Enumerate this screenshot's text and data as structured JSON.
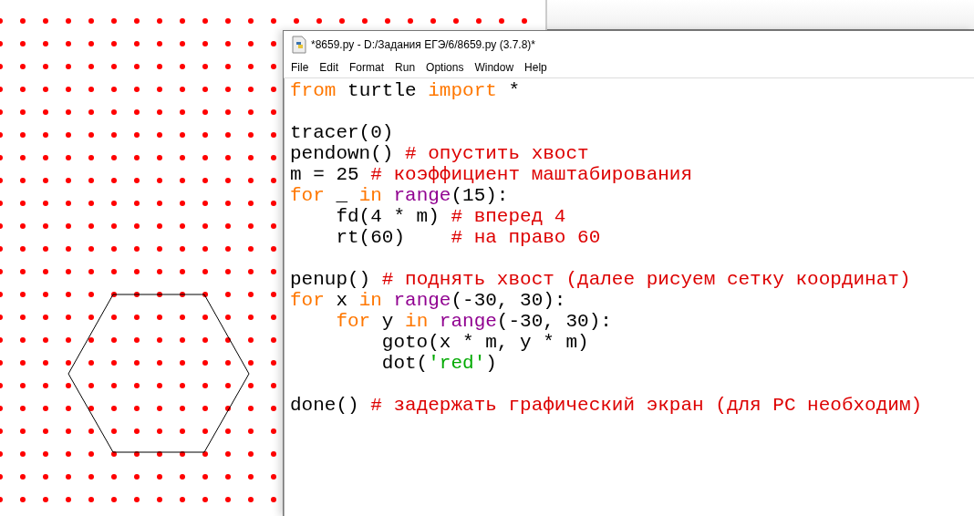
{
  "editor": {
    "title": "*8659.py - D:/Задания ЕГЭ/6/8659.py (3.7.8)*",
    "menu": [
      "File",
      "Edit",
      "Format",
      "Run",
      "Options",
      "Window",
      "Help"
    ],
    "code_lines": [
      {
        "kind": "code",
        "segments": [
          {
            "kind": "keyword",
            "text": "from"
          },
          {
            "kind": "plain",
            "text": " turtle "
          },
          {
            "kind": "keyword",
            "text": "import"
          },
          {
            "kind": "plain",
            "text": " *"
          }
        ]
      },
      {
        "kind": "blank"
      },
      {
        "kind": "code",
        "segments": [
          {
            "kind": "plain",
            "text": "tracer(0)"
          }
        ]
      },
      {
        "kind": "code",
        "segments": [
          {
            "kind": "plain",
            "text": "pendown() "
          },
          {
            "kind": "comment",
            "text": "# опустить хвост"
          }
        ]
      },
      {
        "kind": "code",
        "segments": [
          {
            "kind": "plain",
            "text": "m = 25 "
          },
          {
            "kind": "comment",
            "text": "# коэффициент маштабирования"
          }
        ]
      },
      {
        "kind": "code",
        "segments": [
          {
            "kind": "keyword",
            "text": "for"
          },
          {
            "kind": "plain",
            "text": " _ "
          },
          {
            "kind": "keyword",
            "text": "in "
          },
          {
            "kind": "builtin",
            "text": "range"
          },
          {
            "kind": "plain",
            "text": "(15):"
          }
        ]
      },
      {
        "kind": "code",
        "segments": [
          {
            "kind": "plain",
            "text": "    fd(4 * m) "
          },
          {
            "kind": "comment",
            "text": "# вперед 4"
          }
        ]
      },
      {
        "kind": "code",
        "segments": [
          {
            "kind": "plain",
            "text": "    rt(60)    "
          },
          {
            "kind": "comment",
            "text": "# на право 60"
          }
        ]
      },
      {
        "kind": "blank"
      },
      {
        "kind": "code",
        "segments": [
          {
            "kind": "plain",
            "text": "penup() "
          },
          {
            "kind": "comment",
            "text": "# поднять хвост (далее рисуем сетку координат)"
          }
        ]
      },
      {
        "kind": "code",
        "segments": [
          {
            "kind": "keyword",
            "text": "for"
          },
          {
            "kind": "plain",
            "text": " x "
          },
          {
            "kind": "keyword",
            "text": "in "
          },
          {
            "kind": "builtin",
            "text": "range"
          },
          {
            "kind": "plain",
            "text": "(-30, 30):"
          }
        ]
      },
      {
        "kind": "code",
        "segments": [
          {
            "kind": "keyword",
            "text": "    for"
          },
          {
            "kind": "plain",
            "text": " y "
          },
          {
            "kind": "keyword",
            "text": "in "
          },
          {
            "kind": "builtin",
            "text": "range"
          },
          {
            "kind": "plain",
            "text": "(-30, 30):"
          }
        ]
      },
      {
        "kind": "code",
        "segments": [
          {
            "kind": "plain",
            "text": "        goto(x * m, y * m)"
          }
        ]
      },
      {
        "kind": "code",
        "segments": [
          {
            "kind": "plain",
            "text": "        dot("
          },
          {
            "kind": "string",
            "text": "'red'"
          },
          {
            "kind": "plain",
            "text": ")"
          }
        ]
      },
      {
        "kind": "blank"
      },
      {
        "kind": "code",
        "segments": [
          {
            "kind": "plain",
            "text": "done() "
          },
          {
            "kind": "comment",
            "text": "# задержать графический экран (для PC необходим)"
          }
        ]
      }
    ]
  }
}
